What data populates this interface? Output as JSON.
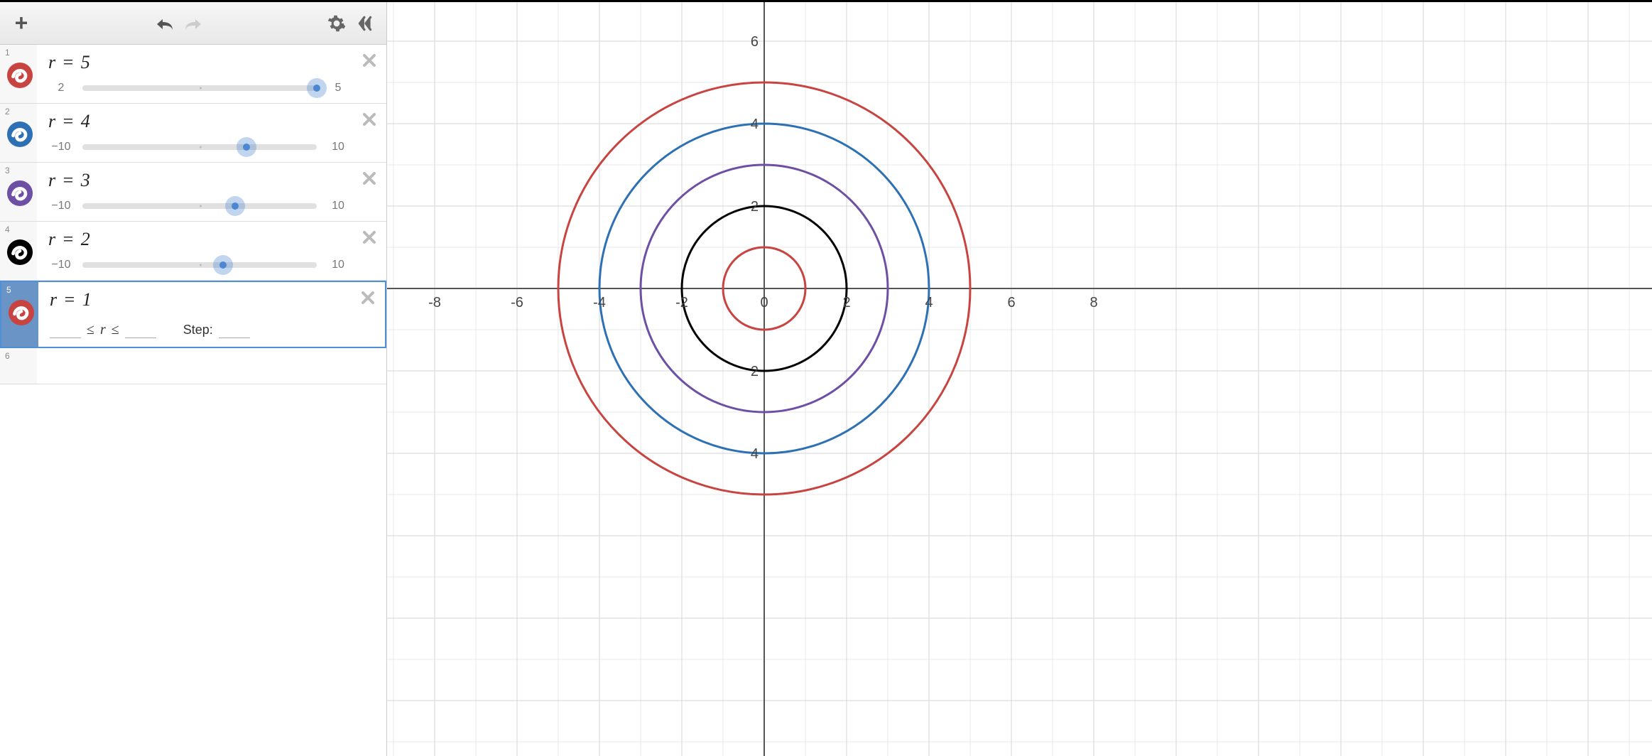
{
  "toolbar": {
    "add_label": "+"
  },
  "expressions": [
    {
      "index": "1",
      "var": "r",
      "value": "5",
      "color": "#c74440",
      "slider": {
        "min": "2",
        "max": "5",
        "value": 5,
        "range_lo": 2,
        "range_hi": 5
      }
    },
    {
      "index": "2",
      "var": "r",
      "value": "4",
      "color": "#2d70b3",
      "slider": {
        "min": "−10",
        "max": "10",
        "value": 4,
        "range_lo": -10,
        "range_hi": 10
      }
    },
    {
      "index": "3",
      "var": "r",
      "value": "3",
      "color": "#6d4fa3",
      "slider": {
        "min": "−10",
        "max": "10",
        "value": 3,
        "range_lo": -10,
        "range_hi": 10
      }
    },
    {
      "index": "4",
      "var": "r",
      "value": "2",
      "color": "#000000",
      "slider": {
        "min": "−10",
        "max": "10",
        "value": 2,
        "range_lo": -10,
        "range_hi": 10
      }
    },
    {
      "index": "5",
      "var": "r",
      "value": "1",
      "color": "#c74440",
      "selected": true,
      "bounds": {
        "lo": "",
        "hi": "",
        "step": "",
        "step_label": "Step:"
      }
    }
  ],
  "empty_index": "6",
  "graph": {
    "x_ticks": [
      "-8",
      "-6",
      "-4",
      "-2",
      "0",
      "2",
      "4",
      "6",
      "8"
    ],
    "x_tick_vals": [
      -8,
      -6,
      -4,
      -2,
      0,
      2,
      4,
      6,
      8
    ],
    "y_ticks_pos": [
      "2",
      "4",
      "6"
    ],
    "y_tick_vals_pos": [
      2,
      4,
      6
    ],
    "y_ticks_neg": [
      "2",
      "4"
    ],
    "y_tick_vals_neg": [
      -2,
      -4
    ],
    "circles": [
      {
        "r": 5,
        "color": "#c74440"
      },
      {
        "r": 4,
        "color": "#2d70b3"
      },
      {
        "r": 3,
        "color": "#6d4fa3"
      },
      {
        "r": 2,
        "color": "#000000"
      },
      {
        "r": 1,
        "color": "#c74440"
      }
    ]
  },
  "chart_data": {
    "type": "scatter",
    "title": "",
    "xlabel": "",
    "ylabel": "",
    "xlim": [
      -9,
      9
    ],
    "ylim": [
      -7,
      7
    ],
    "grid": true,
    "series": [
      {
        "name": "r = 5",
        "shape": "circle",
        "center": [
          0,
          0
        ],
        "radius": 5,
        "color": "#c74440"
      },
      {
        "name": "r = 4",
        "shape": "circle",
        "center": [
          0,
          0
        ],
        "radius": 4,
        "color": "#2d70b3"
      },
      {
        "name": "r = 3",
        "shape": "circle",
        "center": [
          0,
          0
        ],
        "radius": 3,
        "color": "#6d4fa3"
      },
      {
        "name": "r = 2",
        "shape": "circle",
        "center": [
          0,
          0
        ],
        "radius": 2,
        "color": "#000000"
      },
      {
        "name": "r = 1",
        "shape": "circle",
        "center": [
          0,
          0
        ],
        "radius": 1,
        "color": "#c74440"
      }
    ]
  }
}
